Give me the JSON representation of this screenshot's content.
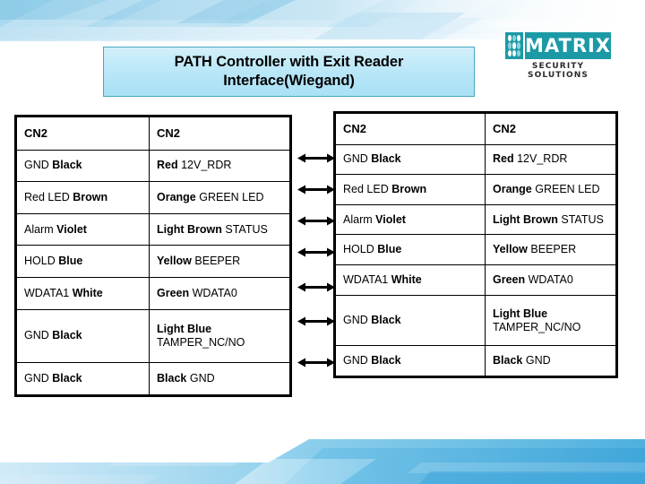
{
  "slide": {
    "title": "PATH Controller with Exit Reader Interface(Wiegand)",
    "title_line1": "PATH Controller with Exit Reader",
    "title_line2": "Interface(Wiegand)"
  },
  "logo": {
    "name": "MATRIX",
    "tagline": "SECURITY SOLUTIONS",
    "brand_color": "#1b9aa6"
  },
  "colors": {
    "title_fill_top": "#d2f0fb",
    "title_fill_bottom": "#a9e1f5",
    "title_border": "#4aa8c0",
    "banner_blue": "#4eb3e0",
    "table_border": "#000000"
  },
  "table_left": {
    "header": [
      "CN2",
      "CN2"
    ],
    "rows": [
      {
        "left_plain": "GND",
        "left_bold": "Black",
        "right_bold": "Red",
        "right_plain": "12V_RDR"
      },
      {
        "left_plain": "Red LED",
        "left_bold": "Brown",
        "right_bold": "Orange",
        "right_plain": "GREEN LED"
      },
      {
        "left_plain": "Alarm",
        "left_bold": "Violet",
        "right_bold": "Light Brown",
        "right_plain": "STATUS"
      },
      {
        "left_plain": "HOLD",
        "left_bold": "Blue",
        "right_bold": "Yellow",
        "right_plain": "BEEPER"
      },
      {
        "left_plain": "WDATA1",
        "left_bold": "White",
        "right_bold": "Green",
        "right_plain": "WDATA0"
      },
      {
        "left_plain": "GND",
        "left_bold": "Black",
        "right_bold": "Light Blue",
        "right_plain": "TAMPER_NC/NO"
      },
      {
        "left_plain": "GND",
        "left_bold": "Black",
        "right_bold": "Black",
        "right_plain": "GND"
      }
    ]
  },
  "table_right": {
    "header": [
      "CN2",
      "CN2"
    ],
    "rows": [
      {
        "left_plain": "GND",
        "left_bold": "Black",
        "right_bold": "Red",
        "right_plain": "12V_RDR"
      },
      {
        "left_plain": "Red LED",
        "left_bold": "Brown",
        "right_bold": "Orange",
        "right_plain": "GREEN LED"
      },
      {
        "left_plain": "Alarm",
        "left_bold": "Violet",
        "right_bold": "Light Brown",
        "right_plain": "STATUS"
      },
      {
        "left_plain": "HOLD",
        "left_bold": "Blue",
        "right_bold": "Yellow",
        "right_plain": "BEEPER"
      },
      {
        "left_plain": "WDATA1",
        "left_bold": "White",
        "right_bold": "Green",
        "right_plain": "WDATA0"
      },
      {
        "left_plain": "GND",
        "left_bold": "Black",
        "right_bold": "Light Blue",
        "right_plain": "TAMPER_NC/NO"
      },
      {
        "left_plain": "GND",
        "left_bold": "Black",
        "right_bold": "Black",
        "right_plain": "GND"
      }
    ]
  },
  "connectors": {
    "icon": "double-headed-arrow",
    "count": 7,
    "tops": [
      170,
      205,
      240,
      275,
      314,
      352,
      398
    ]
  }
}
